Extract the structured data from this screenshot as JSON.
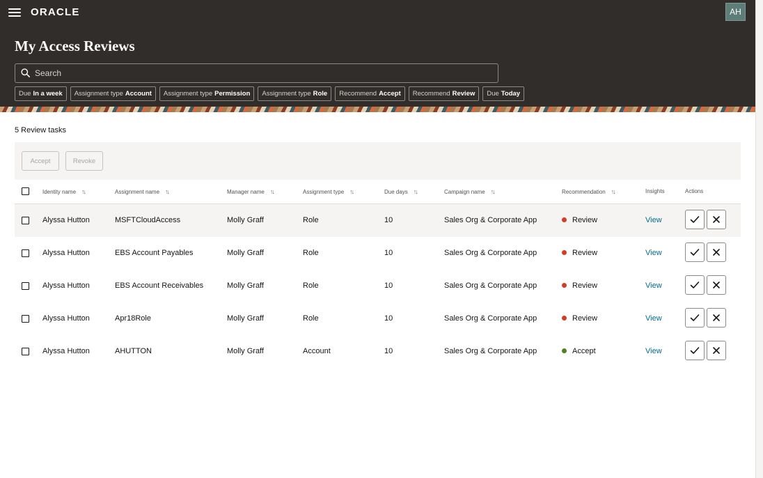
{
  "header": {
    "logo": "ORACLE",
    "avatar_initials": "AH",
    "page_title": "My Access Reviews",
    "search_placeholder": "Search",
    "chips": [
      {
        "prefix": "Due",
        "value": "In a week"
      },
      {
        "prefix": "Assignment type",
        "value": "Account"
      },
      {
        "prefix": "Assignment type",
        "value": "Permission"
      },
      {
        "prefix": "Assignment type",
        "value": "Role"
      },
      {
        "prefix": "Recommend",
        "value": "Accept"
      },
      {
        "prefix": "Recommend",
        "value": "Review"
      },
      {
        "prefix": "Due",
        "value": "Today"
      }
    ]
  },
  "tasks": {
    "count_label": "5 Review tasks",
    "toolbar": {
      "accept_label": "Accept",
      "revoke_label": "Revoke"
    },
    "columns": {
      "identity": "Identity name",
      "assignment": "Assignment name",
      "manager": "Manager name",
      "type": "Assignment type",
      "due": "Due days",
      "campaign": "Campaign name",
      "recommendation": "Recommendation",
      "insights": "Insights",
      "actions": "Actions"
    },
    "rows": [
      {
        "identity": "Alyssa Hutton",
        "assignment": "MSFTCloudAccess",
        "manager": "Molly Graff",
        "type": "Role",
        "due": "10",
        "campaign": "Sales Org & Corporate App",
        "recommendation": "Review",
        "rec_color": "#d63b25",
        "insights": "View"
      },
      {
        "identity": "Alyssa Hutton",
        "assignment": "EBS Account Payables",
        "manager": "Molly Graff",
        "type": "Role",
        "due": "10",
        "campaign": "Sales Org & Corporate App",
        "recommendation": "Review",
        "rec_color": "#d63b25",
        "insights": "View"
      },
      {
        "identity": "Alyssa Hutton",
        "assignment": "EBS Account Receivables",
        "manager": "Molly Graff",
        "type": "Role",
        "due": "10",
        "campaign": "Sales Org & Corporate App",
        "recommendation": "Review",
        "rec_color": "#d63b25",
        "insights": "View"
      },
      {
        "identity": "Alyssa Hutton",
        "assignment": "Apr18Role",
        "manager": "Molly Graff",
        "type": "Role",
        "due": "10",
        "campaign": "Sales Org & Corporate App",
        "recommendation": "Review",
        "rec_color": "#d63b25",
        "insights": "View"
      },
      {
        "identity": "Alyssa Hutton",
        "assignment": "AHUTTON",
        "manager": "Molly Graff",
        "type": "Account",
        "due": "10",
        "campaign": "Sales Org & Corporate App",
        "recommendation": "Accept",
        "rec_color": "#508223",
        "insights": "View"
      }
    ]
  },
  "icons": {
    "menu": "hamburger-menu-icon",
    "search": "search-icon",
    "sort": "sort-icon",
    "accept": "checkmark-icon",
    "revoke": "close-icon"
  }
}
